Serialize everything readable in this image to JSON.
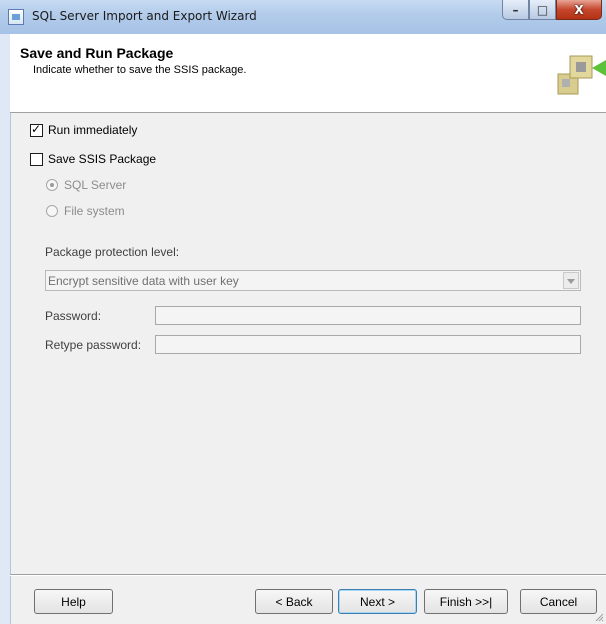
{
  "window": {
    "title": "SQL Server Import and Export Wizard",
    "minimize_glyph": "–",
    "maximize_glyph": "□",
    "close_glyph": "X"
  },
  "header": {
    "title": "Save and Run Package",
    "subtitle": "Indicate whether to save the SSIS package."
  },
  "options": {
    "run_immediately": {
      "label": "Run immediately",
      "checked": true
    },
    "save_ssis_package": {
      "label": "Save SSIS Package",
      "checked": false
    },
    "sql_server": {
      "label": "SQL Server",
      "selected": true,
      "enabled": false
    },
    "file_system": {
      "label": "File system",
      "selected": false,
      "enabled": false
    }
  },
  "protection": {
    "label": "Package protection level:",
    "value": "Encrypt sensitive data with user key"
  },
  "password": {
    "label": "Password:",
    "value": ""
  },
  "retype_password": {
    "label": "Retype password:",
    "value": ""
  },
  "buttons": {
    "help": "Help",
    "back": "< Back",
    "next": "Next >",
    "finish": "Finish >>|",
    "cancel": "Cancel"
  },
  "icons": {
    "app": "wizard-app-icon",
    "logo": "package-puzzle-icon",
    "check": "checkmark-icon",
    "dropdown": "chevron-down-icon",
    "grip": "resize-grip-icon"
  },
  "colors": {
    "titlebar": "#b2cbea",
    "close_button": "#c5472d",
    "disabled_text": "#8c8c8c",
    "logo_green": "#5cc23a",
    "logo_tan": "#d8cc8e"
  }
}
